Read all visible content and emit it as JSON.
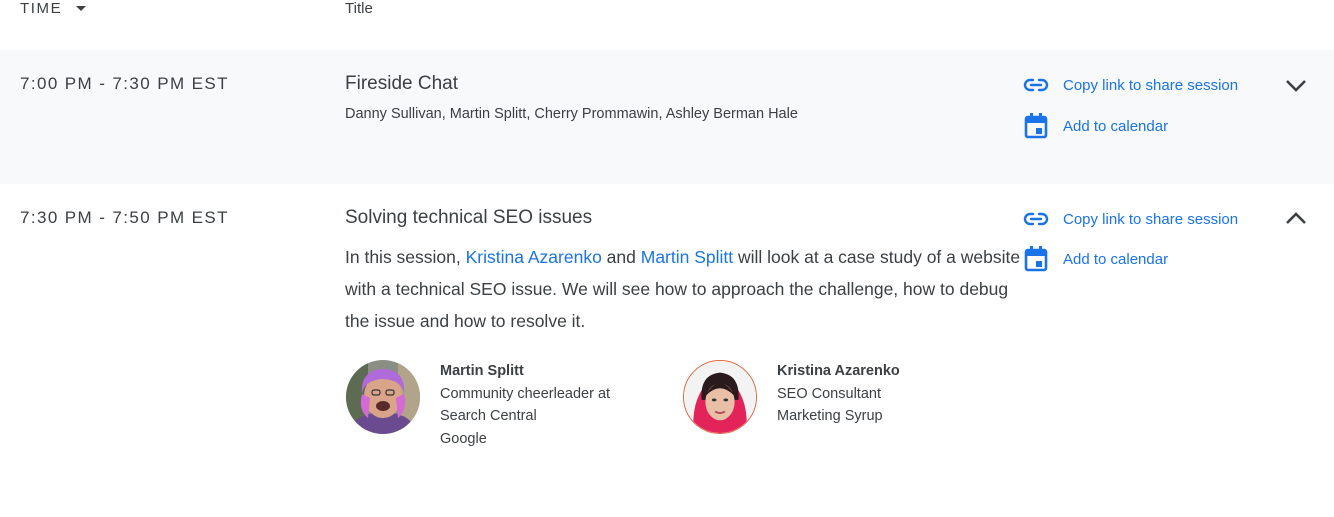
{
  "header": {
    "time_label": "TIME",
    "title_label": "Title"
  },
  "sessions": [
    {
      "time": "7:00 PM - 7:30 PM EST",
      "title": "Fireside Chat",
      "speakers_line": "Danny Sullivan, Martin Splitt, Cherry Prommawin, Ashley Berman Hale",
      "copy_link_label": "Copy link to share session",
      "calendar_label": "Add to calendar",
      "expanded": false
    },
    {
      "time": "7:30 PM - 7:50 PM EST",
      "title": "Solving technical SEO issues",
      "description": {
        "part1": "In this session, ",
        "link1": "Kristina Azarenko",
        "part2": " and ",
        "link2": "Martin Splitt",
        "part3": " will look at a case study of a website with a technical SEO issue. We will see how to approach the challenge, how to debug the issue and how to resolve it."
      },
      "copy_link_label": "Copy link to share session",
      "calendar_label": "Add to calendar",
      "expanded": true,
      "speakers": [
        {
          "name": "Martin Splitt",
          "role_line1": "Community cheerleader at",
          "role_line2": "Search Central",
          "company": "Google"
        },
        {
          "name": "Kristina Azarenko",
          "role_line1": "SEO Consultant",
          "role_line2": "Marketing Syrup"
        }
      ]
    }
  ],
  "colors": {
    "accent": "#1a73e8",
    "row_highlight": "#f8f9fa",
    "text": "#3c4043"
  }
}
